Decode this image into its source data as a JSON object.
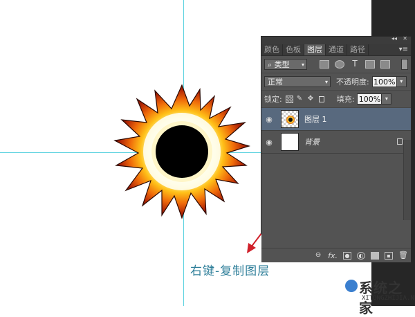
{
  "panel": {
    "tabs": [
      "颜色",
      "色板",
      "图层",
      "通道",
      "路径"
    ],
    "active_tab": "图层",
    "filter_kind": "类型",
    "blend_mode": "正常",
    "opacity_label": "不透明度:",
    "opacity_value": "100%",
    "lock_label": "锁定:",
    "fill_label": "填充:",
    "fill_value": "100%",
    "layers": [
      {
        "name": "图层 1",
        "selected": true
      },
      {
        "name": "背景",
        "locked": true
      }
    ],
    "bottom_icons": [
      "link-icon",
      "fx-icon",
      "mask-icon",
      "adjustment-icon",
      "folder-icon",
      "new-layer-icon",
      "trash-icon"
    ]
  },
  "caption": "右键-复制图层",
  "watermark": {
    "text": "系统之家",
    "url": "XITONGZHIJIA.NET"
  },
  "colors": {
    "guide": "#5fd3e0",
    "caption": "#2f7f9a",
    "arrow": "#d0202a",
    "panel_bg": "#535353",
    "selected_layer": "#58697e"
  }
}
